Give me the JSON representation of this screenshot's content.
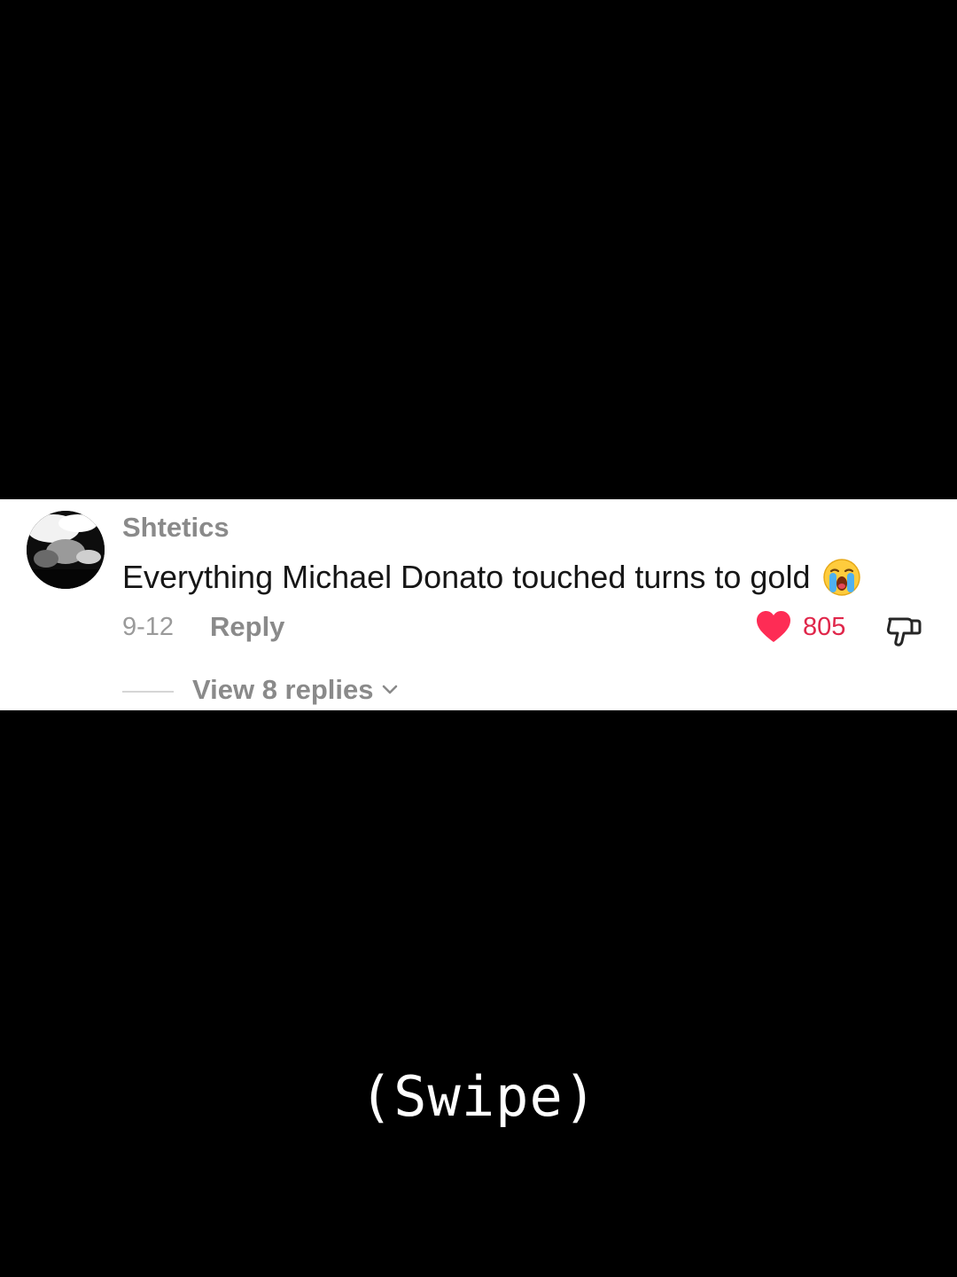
{
  "comment": {
    "username": "Shtetics",
    "text": "Everything Michael Donato touched turns to gold",
    "emoji": "loudly-crying-face-icon",
    "date": "9-12",
    "reply_label": "Reply",
    "like_count": "805",
    "like_color": "#fe2c55",
    "view_replies_label": "View 8 replies"
  },
  "caption": {
    "text": "(Swipe)"
  }
}
